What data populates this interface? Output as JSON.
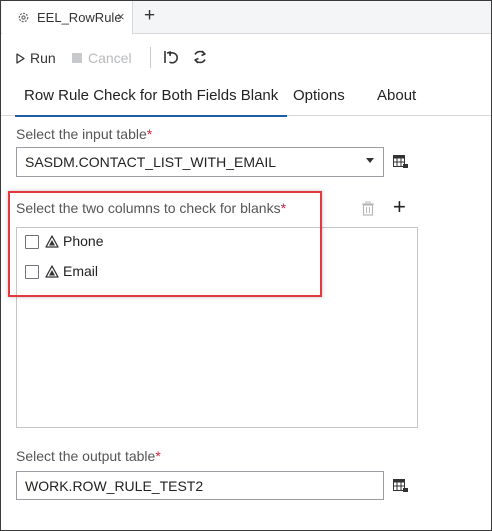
{
  "tabstrip": {
    "file_tab": {
      "name": "EEL_RowRule",
      "close": "×"
    },
    "add_tab": "+"
  },
  "toolbar": {
    "run_label": "Run",
    "cancel_label": "Cancel"
  },
  "subtabs": [
    {
      "label": "Row Rule Check for Both Fields Blank",
      "active": true
    },
    {
      "label": "Options",
      "active": false
    },
    {
      "label": "About",
      "active": false
    }
  ],
  "form": {
    "input_table": {
      "label": "Select the input table",
      "required_mark": "*",
      "value": "SASDM.CONTACT_LIST_WITH_EMAIL"
    },
    "columns": {
      "label": "Select the two columns to check for blanks",
      "required_mark": "*",
      "add_symbol": "+",
      "items": [
        {
          "name": "Phone",
          "checked": false
        },
        {
          "name": "Email",
          "checked": false
        }
      ]
    },
    "output_table": {
      "label": "Select the output table",
      "required_mark": "*",
      "value": "WORK.ROW_RULE_TEST2"
    }
  },
  "colors": {
    "accent": "#1c5fa8",
    "required": "#d0243a",
    "highlight": "#e3383f"
  }
}
